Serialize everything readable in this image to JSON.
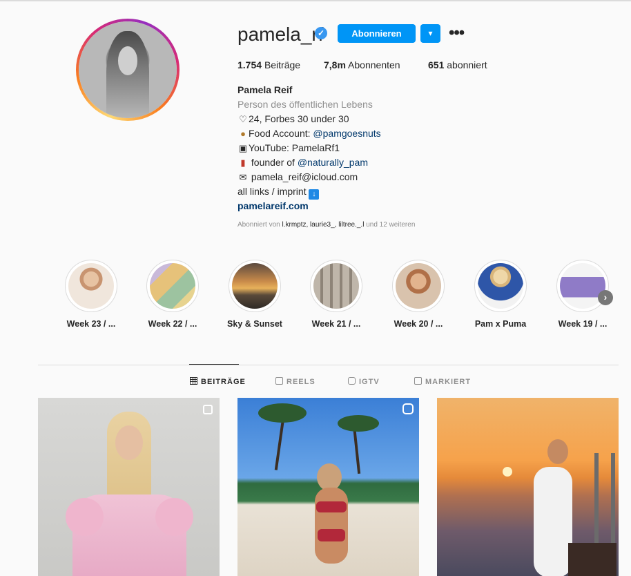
{
  "profile": {
    "username": "pamela_rf",
    "follow_label": "Abonnieren",
    "stats": {
      "posts_count": "1.754",
      "posts_label": "Beiträge",
      "followers_count": "7,8m",
      "followers_label": "Abonnenten",
      "following_count": "651",
      "following_label": "abonniert"
    },
    "bio": {
      "name": "Pamela Reif",
      "category": "Person des öffentlichen Lebens",
      "line1": "24, Forbes 30 under 30",
      "line2_text": "Food Account: ",
      "line2_link": "@pamgoesnuts",
      "line3": "YouTube: PamelaRf1",
      "line4_text": "founder of ",
      "line4_link": "@naturally_pam",
      "line5": "pamela_reif@icloud.com",
      "line6": "all links / imprint",
      "website": "pamelareif.com"
    },
    "followed_by": {
      "prefix": "Abonniert von ",
      "names": "l.krmptz, laurie3_, liltree._.l",
      "suffix": " und 12 weiteren"
    }
  },
  "highlights": [
    {
      "label": "Week 23 / ..."
    },
    {
      "label": "Week 22 / ..."
    },
    {
      "label": "Sky & Sunset"
    },
    {
      "label": "Week 21 / ..."
    },
    {
      "label": "Week 20 / ..."
    },
    {
      "label": "Pam x Puma"
    },
    {
      "label": "Week 19 / ..."
    }
  ],
  "tabs": [
    {
      "label": "BEITRÄGE"
    },
    {
      "label": "REELS"
    },
    {
      "label": "IGTV"
    },
    {
      "label": "MARKIERT"
    }
  ],
  "icons": {
    "verified": "verified-badge-icon",
    "dropdown": "chevron-down-icon",
    "more": "more-options-icon",
    "heart": "heart-icon",
    "peanut": "peanut-icon",
    "tv": "tv-icon",
    "bottle": "bottle-icon",
    "envelope": "envelope-icon",
    "arrow": "down-arrow-icon",
    "grid": "grid-icon",
    "reels": "reels-icon",
    "igtv": "igtv-icon",
    "tagged": "tagged-icon",
    "carousel": "carousel-icon",
    "reel_badge": "reel-badge-icon",
    "next": "chevron-right-icon"
  },
  "colors": {
    "accent": "#0095f6",
    "link": "#00376b",
    "muted": "#8e8e8e",
    "text": "#262626"
  }
}
